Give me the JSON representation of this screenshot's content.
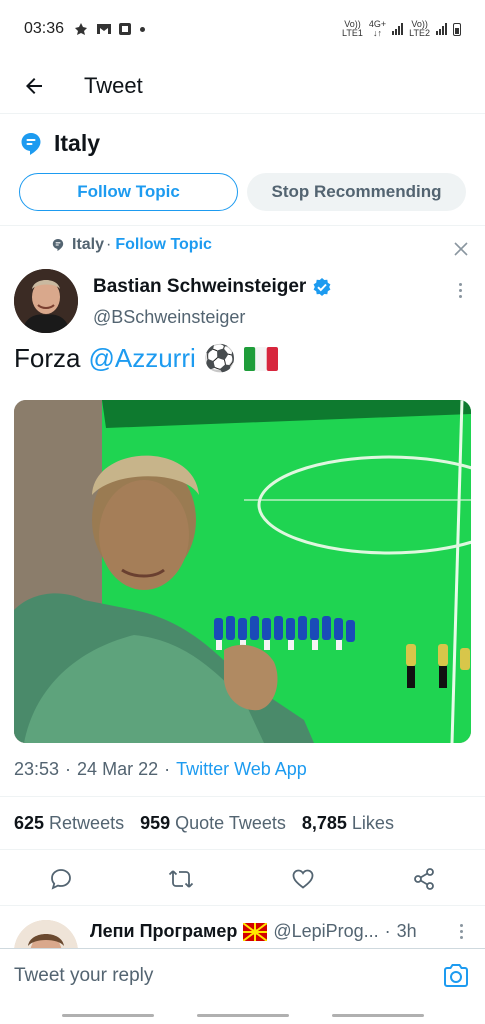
{
  "status_bar": {
    "time": "03:36",
    "net1_top": "Vo))",
    "net1_bottom": "LTE1",
    "net_type": "4G+",
    "net2_top": "Vo))",
    "net2_bottom": "LTE2"
  },
  "header": {
    "title": "Tweet"
  },
  "topic": {
    "name": "Italy",
    "follow_label": "Follow Topic",
    "stop_label": "Stop Recommending"
  },
  "tweet": {
    "context_topic": "Italy",
    "context_sep": "·",
    "context_follow": "Follow Topic",
    "author_name": "Bastian Schweinsteiger",
    "author_handle": "@BSchweinsteiger",
    "text_prefix": "Forza",
    "mention": "@Azzurri",
    "emoji_ball": "⚽",
    "time": "23:53",
    "sep1": "·",
    "date": "24 Mar 22",
    "sep2": "·",
    "source": "Twitter Web App",
    "stats": {
      "retweets_num": "625",
      "retweets_label": "Retweets",
      "quotes_num": "959",
      "quotes_label": "Quote Tweets",
      "likes_num": "8,785",
      "likes_label": "Likes"
    }
  },
  "reply_preview": {
    "name": "Лепи Програмер",
    "handle": "@LepiProg...",
    "sep": "·",
    "time": "3h"
  },
  "reply_bar": {
    "placeholder": "Tweet your reply"
  },
  "colors": {
    "accent": "#1d9bf0",
    "text": "#0f1419",
    "secondary": "#536471",
    "pitch_green": "#1fd451"
  }
}
